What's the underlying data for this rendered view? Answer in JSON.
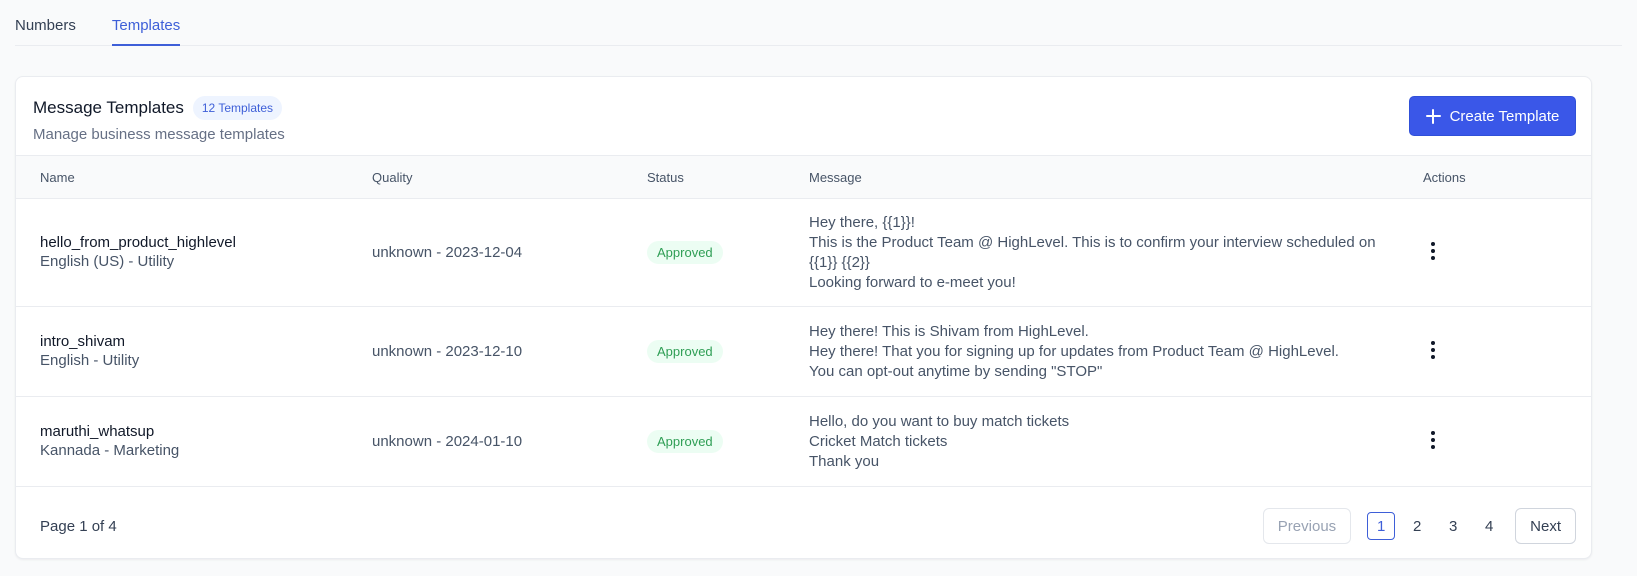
{
  "tabs": [
    {
      "label": "Numbers",
      "active": false
    },
    {
      "label": "Templates",
      "active": true
    }
  ],
  "header": {
    "title": "Message Templates",
    "count_badge": "12 Templates",
    "subtitle": "Manage business message templates",
    "create_button": "Create Template"
  },
  "table": {
    "columns": [
      "Name",
      "Quality",
      "Status",
      "Message",
      "Actions"
    ],
    "rows": [
      {
        "name": "hello_from_product_highlevel",
        "meta": "English (US) - Utility",
        "quality": "unknown - 2023-12-04",
        "status": "Approved",
        "message": [
          "Hey there, {{1}}!",
          "This is the Product Team @ HighLevel. This is to confirm your interview scheduled on",
          "{{1}} {{2}}",
          "Looking forward to e-meet you!"
        ]
      },
      {
        "name": "intro_shivam",
        "meta": "English - Utility",
        "quality": "unknown - 2023-12-10",
        "status": "Approved",
        "message": [
          "Hey there! This is Shivam from HighLevel.",
          "Hey there! That you for signing up for updates from Product Team @ HighLevel.",
          "You can opt-out anytime by sending \"STOP\""
        ]
      },
      {
        "name": "maruthi_whatsup",
        "meta": "Kannada - Marketing",
        "quality": "unknown - 2024-01-10",
        "status": "Approved",
        "message": [
          "Hello, do you want to buy match tickets",
          "Cricket Match tickets",
          "Thank you"
        ]
      }
    ]
  },
  "pagination": {
    "info": "Page 1 of 4",
    "previous": "Previous",
    "next": "Next",
    "pages": [
      "1",
      "2",
      "3",
      "4"
    ],
    "current": "1"
  },
  "colors": {
    "accent": "#3e5fd8",
    "primary_button": "#3a57e8",
    "approved_text": "#2f9e55",
    "approved_bg": "#ecfdf3"
  },
  "icons": {
    "create": "plus-icon",
    "row_actions": "more-vertical-icon"
  }
}
